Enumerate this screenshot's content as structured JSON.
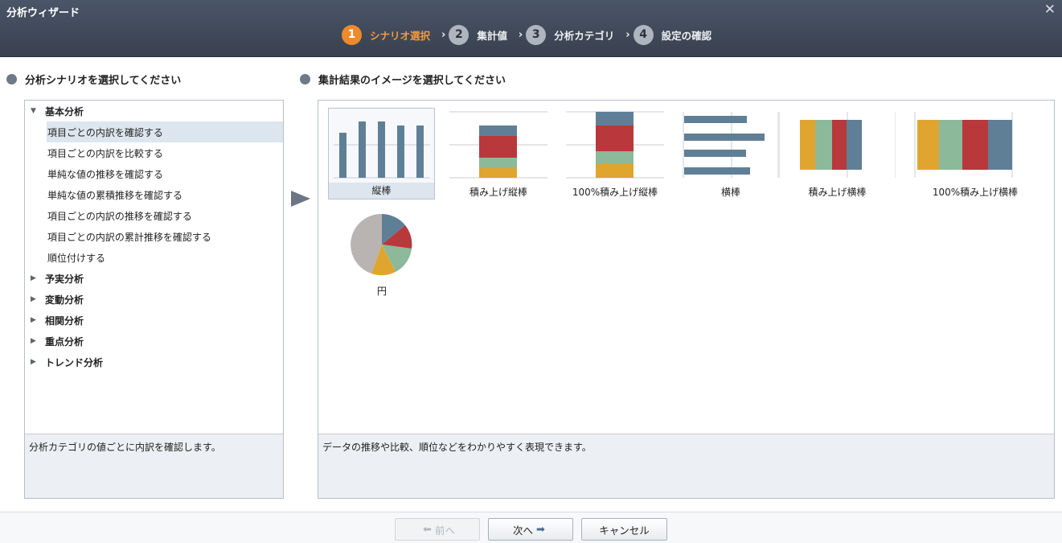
{
  "window": {
    "title": "分析ウィザード",
    "close_glyph": "✕"
  },
  "steps": [
    {
      "num": "1",
      "label": "シナリオ選択",
      "active": true
    },
    {
      "num": "2",
      "label": "集計値",
      "active": false
    },
    {
      "num": "3",
      "label": "分析カテゴリ",
      "active": false
    },
    {
      "num": "4",
      "label": "設定の確認",
      "active": false
    }
  ],
  "step_separator": "›",
  "left": {
    "title": "分析シナリオを選択してください",
    "tree": {
      "group_expanded": {
        "label": "基本分析",
        "icon": "triangle-down-icon"
      },
      "items": [
        "項目ごとの内訳を確認する",
        "項目ごとの内訳を比較する",
        "単純な値の推移を確認する",
        "単純な値の累積推移を確認する",
        "項目ごとの内訳の推移を確認する",
        "項目ごとの内訳の累計推移を確認する",
        "順位付けする"
      ],
      "selected_index": 0,
      "collapsed_groups": [
        "予実分析",
        "変動分析",
        "相関分析",
        "重点分析",
        "トレンド分析"
      ]
    },
    "description": "分析カテゴリの値ごとに内訳を確認します。"
  },
  "right": {
    "title": "集計結果のイメージを選択してください",
    "charts": [
      {
        "label": "縦棒",
        "icon": "column-chart-icon",
        "selected": true
      },
      {
        "label": "積み上げ縦棒",
        "icon": "stacked-column-chart-icon",
        "selected": false
      },
      {
        "label": "100%積み上げ縦棒",
        "icon": "stacked-100-column-chart-icon",
        "selected": false
      },
      {
        "label": "横棒",
        "icon": "bar-chart-icon",
        "selected": false
      },
      {
        "label": "積み上げ横棒",
        "icon": "stacked-bar-chart-icon",
        "selected": false
      },
      {
        "label": "100%積み上げ横棒",
        "icon": "stacked-100-bar-chart-icon",
        "selected": false
      },
      {
        "label": "円",
        "icon": "pie-chart-icon",
        "selected": false
      }
    ],
    "description": "データの推移や比較、順位などをわかりやすく表現できます。"
  },
  "footer": {
    "prev_label": "前へ",
    "prev_icon": "arrow-left-icon",
    "next_label": "次へ",
    "next_icon": "arrow-right-icon",
    "cancel_label": "キャンセル"
  },
  "colors": {
    "header_bg": "#3f4756",
    "active_step": "#ee8a2c",
    "steel_blue": "#5f7f97",
    "red": "#b8383c",
    "green": "#8cb99a",
    "gold": "#e0a52e",
    "pie_gray": "#b9b4b2",
    "selection": "#dde5ef"
  }
}
